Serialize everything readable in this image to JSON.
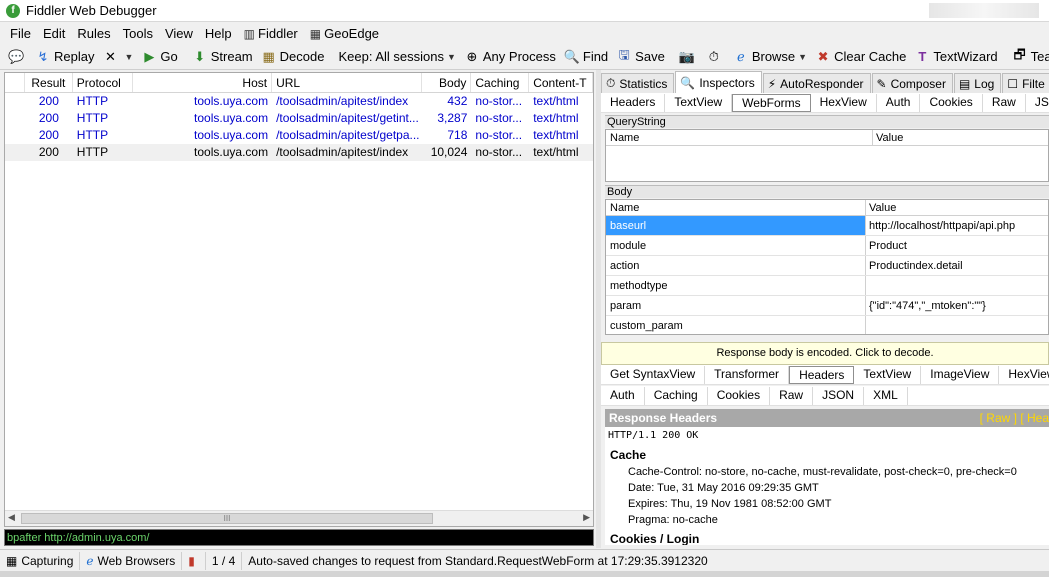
{
  "window": {
    "title": "Fiddler Web Debugger",
    "icon": "fiddler-logo-icon"
  },
  "menu": [
    "File",
    "Edit",
    "Rules",
    "Tools",
    "View",
    "Help",
    "Fiddler",
    "GeoEdge"
  ],
  "toolbar": {
    "replay": "Replay",
    "remove": "",
    "go": "Go",
    "stream": "Stream",
    "decode": "Decode",
    "keep": "Keep: All sessions",
    "process": "Any Process",
    "find": "Find",
    "save": "Save",
    "browse": "Browse",
    "clear_cache": "Clear Cache",
    "text_wizard": "TextWizard",
    "tearoff": "Tearoff"
  },
  "sessions": {
    "columns": [
      "Result",
      "Protocol",
      "Host",
      "URL",
      "Body",
      "Caching",
      "Content-T"
    ],
    "rows": [
      {
        "result": "200",
        "protocol": "HTTP",
        "host": "tools.uya.com",
        "url": "/toolsadmin/apitest/index",
        "body": "432",
        "caching": "no-stor...",
        "ctype": "text/html"
      },
      {
        "result": "200",
        "protocol": "HTTP",
        "host": "tools.uya.com",
        "url": "/toolsadmin/apitest/getint...",
        "body": "3,287",
        "caching": "no-stor...",
        "ctype": "text/html"
      },
      {
        "result": "200",
        "protocol": "HTTP",
        "host": "tools.uya.com",
        "url": "/toolsadmin/apitest/getpa...",
        "body": "718",
        "caching": "no-stor...",
        "ctype": "text/html"
      },
      {
        "result": "200",
        "protocol": "HTTP",
        "host": "tools.uya.com",
        "url": "/toolsadmin/apitest/index",
        "body": "10,024",
        "caching": "no-stor...",
        "ctype": "text/html"
      }
    ],
    "scroll_grip": "III"
  },
  "quickexec": {
    "value": "bpafter http://admin.uya.com/"
  },
  "inspector_tabs": [
    "Statistics",
    "Inspectors",
    "AutoResponder",
    "Composer",
    "Log",
    "Filte"
  ],
  "request_tabs": [
    "Headers",
    "TextView",
    "WebForms",
    "HexView",
    "Auth",
    "Cookies",
    "Raw",
    "JSO"
  ],
  "querystring": {
    "label": "QueryString",
    "col_name": "Name",
    "col_value": "Value"
  },
  "body": {
    "label": "Body",
    "col_name": "Name",
    "col_value": "Value",
    "rows": [
      {
        "name": "baseurl",
        "value": "http://localhost/httpapi/api.php"
      },
      {
        "name": "module",
        "value": "Product"
      },
      {
        "name": "action",
        "value": "Productindex.detail"
      },
      {
        "name": "methodtype",
        "value": ""
      },
      {
        "name": "param",
        "value": "{\"id\":\"474\",\"_mtoken\":\"\"}"
      },
      {
        "name": "custom_param",
        "value": ""
      }
    ]
  },
  "encoded_notice": "Response body is encoded. Click to decode.",
  "response_tabs_row1": [
    "Get SyntaxView",
    "Transformer",
    "Headers",
    "TextView",
    "ImageView",
    "HexView"
  ],
  "response_tabs_row2": [
    "Auth",
    "Caching",
    "Cookies",
    "Raw",
    "JSON",
    "XML"
  ],
  "response_headers": {
    "title": "Response Headers",
    "links": "[ Raw ]   [ Hea",
    "status": "HTTP/1.1 200 OK",
    "groups": [
      {
        "name": "Cache",
        "items": [
          "Cache-Control: no-store, no-cache, must-revalidate, post-check=0, pre-check=0",
          "Date: Tue, 31 May 2016 09:29:35 GMT",
          "Expires: Thu, 19 Nov 1981 08:52:00 GMT",
          "Pragma: no-cache"
        ]
      },
      {
        "name": "Cookies / Login",
        "items": []
      }
    ]
  },
  "statusbar": {
    "capturing": "Capturing",
    "browsers": "Web Browsers",
    "count": "1 / 4",
    "message": "Auto-saved changes to request from Standard.RequestWebForm at 17:29:35.3912320"
  }
}
